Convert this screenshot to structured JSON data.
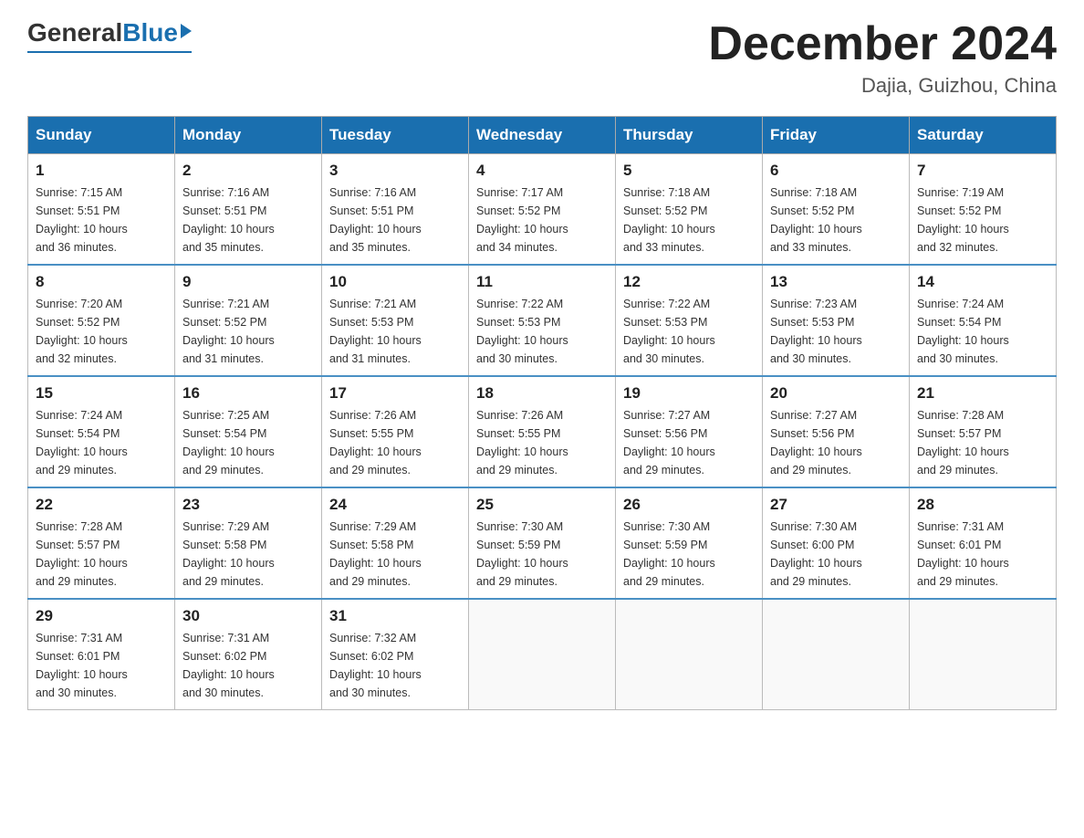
{
  "logo": {
    "general": "General",
    "blue": "Blue"
  },
  "title": {
    "month_year": "December 2024",
    "location": "Dajia, Guizhou, China"
  },
  "days_of_week": [
    "Sunday",
    "Monday",
    "Tuesday",
    "Wednesday",
    "Thursday",
    "Friday",
    "Saturday"
  ],
  "weeks": [
    [
      {
        "day": "1",
        "sunrise": "7:15 AM",
        "sunset": "5:51 PM",
        "daylight": "10 hours and 36 minutes."
      },
      {
        "day": "2",
        "sunrise": "7:16 AM",
        "sunset": "5:51 PM",
        "daylight": "10 hours and 35 minutes."
      },
      {
        "day": "3",
        "sunrise": "7:16 AM",
        "sunset": "5:51 PM",
        "daylight": "10 hours and 35 minutes."
      },
      {
        "day": "4",
        "sunrise": "7:17 AM",
        "sunset": "5:52 PM",
        "daylight": "10 hours and 34 minutes."
      },
      {
        "day": "5",
        "sunrise": "7:18 AM",
        "sunset": "5:52 PM",
        "daylight": "10 hours and 33 minutes."
      },
      {
        "day": "6",
        "sunrise": "7:18 AM",
        "sunset": "5:52 PM",
        "daylight": "10 hours and 33 minutes."
      },
      {
        "day": "7",
        "sunrise": "7:19 AM",
        "sunset": "5:52 PM",
        "daylight": "10 hours and 32 minutes."
      }
    ],
    [
      {
        "day": "8",
        "sunrise": "7:20 AM",
        "sunset": "5:52 PM",
        "daylight": "10 hours and 32 minutes."
      },
      {
        "day": "9",
        "sunrise": "7:21 AM",
        "sunset": "5:52 PM",
        "daylight": "10 hours and 31 minutes."
      },
      {
        "day": "10",
        "sunrise": "7:21 AM",
        "sunset": "5:53 PM",
        "daylight": "10 hours and 31 minutes."
      },
      {
        "day": "11",
        "sunrise": "7:22 AM",
        "sunset": "5:53 PM",
        "daylight": "10 hours and 30 minutes."
      },
      {
        "day": "12",
        "sunrise": "7:22 AM",
        "sunset": "5:53 PM",
        "daylight": "10 hours and 30 minutes."
      },
      {
        "day": "13",
        "sunrise": "7:23 AM",
        "sunset": "5:53 PM",
        "daylight": "10 hours and 30 minutes."
      },
      {
        "day": "14",
        "sunrise": "7:24 AM",
        "sunset": "5:54 PM",
        "daylight": "10 hours and 30 minutes."
      }
    ],
    [
      {
        "day": "15",
        "sunrise": "7:24 AM",
        "sunset": "5:54 PM",
        "daylight": "10 hours and 29 minutes."
      },
      {
        "day": "16",
        "sunrise": "7:25 AM",
        "sunset": "5:54 PM",
        "daylight": "10 hours and 29 minutes."
      },
      {
        "day": "17",
        "sunrise": "7:26 AM",
        "sunset": "5:55 PM",
        "daylight": "10 hours and 29 minutes."
      },
      {
        "day": "18",
        "sunrise": "7:26 AM",
        "sunset": "5:55 PM",
        "daylight": "10 hours and 29 minutes."
      },
      {
        "day": "19",
        "sunrise": "7:27 AM",
        "sunset": "5:56 PM",
        "daylight": "10 hours and 29 minutes."
      },
      {
        "day": "20",
        "sunrise": "7:27 AM",
        "sunset": "5:56 PM",
        "daylight": "10 hours and 29 minutes."
      },
      {
        "day": "21",
        "sunrise": "7:28 AM",
        "sunset": "5:57 PM",
        "daylight": "10 hours and 29 minutes."
      }
    ],
    [
      {
        "day": "22",
        "sunrise": "7:28 AM",
        "sunset": "5:57 PM",
        "daylight": "10 hours and 29 minutes."
      },
      {
        "day": "23",
        "sunrise": "7:29 AM",
        "sunset": "5:58 PM",
        "daylight": "10 hours and 29 minutes."
      },
      {
        "day": "24",
        "sunrise": "7:29 AM",
        "sunset": "5:58 PM",
        "daylight": "10 hours and 29 minutes."
      },
      {
        "day": "25",
        "sunrise": "7:30 AM",
        "sunset": "5:59 PM",
        "daylight": "10 hours and 29 minutes."
      },
      {
        "day": "26",
        "sunrise": "7:30 AM",
        "sunset": "5:59 PM",
        "daylight": "10 hours and 29 minutes."
      },
      {
        "day": "27",
        "sunrise": "7:30 AM",
        "sunset": "6:00 PM",
        "daylight": "10 hours and 29 minutes."
      },
      {
        "day": "28",
        "sunrise": "7:31 AM",
        "sunset": "6:01 PM",
        "daylight": "10 hours and 29 minutes."
      }
    ],
    [
      {
        "day": "29",
        "sunrise": "7:31 AM",
        "sunset": "6:01 PM",
        "daylight": "10 hours and 30 minutes."
      },
      {
        "day": "30",
        "sunrise": "7:31 AM",
        "sunset": "6:02 PM",
        "daylight": "10 hours and 30 minutes."
      },
      {
        "day": "31",
        "sunrise": "7:32 AM",
        "sunset": "6:02 PM",
        "daylight": "10 hours and 30 minutes."
      },
      null,
      null,
      null,
      null
    ]
  ],
  "labels": {
    "sunrise": "Sunrise:",
    "sunset": "Sunset:",
    "daylight": "Daylight:"
  }
}
